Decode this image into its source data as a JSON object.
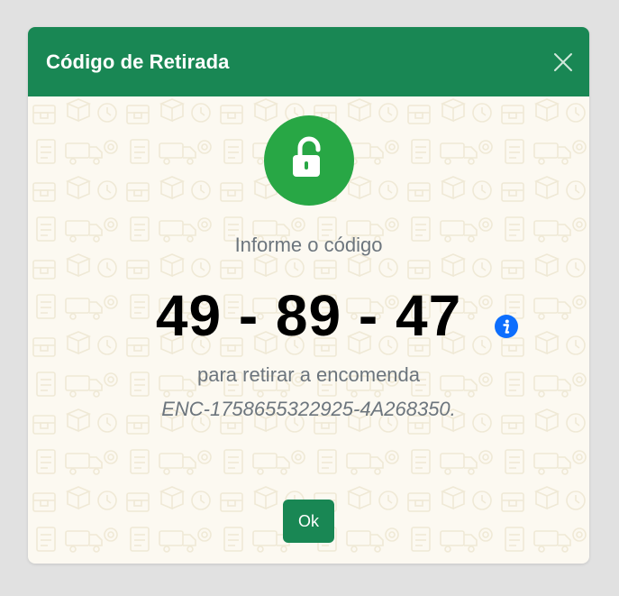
{
  "modal": {
    "title": "Código de Retirada",
    "prompt": "Informe o código",
    "code_parts": [
      "49",
      "-",
      "89",
      "-",
      "47"
    ],
    "subtext": "para retirar a encomenda",
    "order_id": "ENC-1758655322925-4A268350.",
    "ok_label": "Ok"
  },
  "colors": {
    "header": "#198754",
    "lock_circle": "#28a745",
    "info_icon": "#0d6efd",
    "muted_text": "#6c757d",
    "body_bg": "#fcf9f1"
  },
  "icons": {
    "close": "close-icon",
    "lock": "unlock-icon",
    "info": "info-icon"
  }
}
